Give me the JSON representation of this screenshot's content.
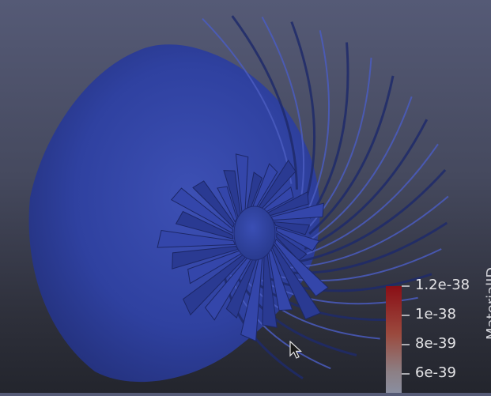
{
  "viewport": {
    "background_top": "#555a76",
    "background_bottom": "#23252d",
    "surface_color": "#2e3f9a",
    "blade_count": 26
  },
  "color_legend": {
    "title": "MaterialID",
    "labels": [
      "1.2e-38",
      "1e-38",
      "8e-39",
      "6e-39"
    ],
    "values": [
      1.2e-38,
      1e-38,
      8e-39,
      6e-39
    ],
    "color_top": "#8a0f16",
    "color_bottom": "#8a8ea0"
  },
  "cursor": {
    "icon": "arrow-cursor-icon"
  }
}
